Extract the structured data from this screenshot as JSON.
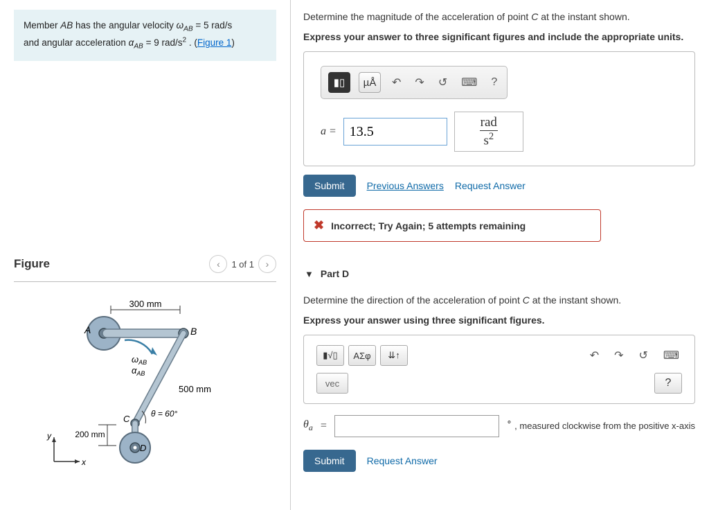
{
  "problem": {
    "prefix": "Member ",
    "member": "AB",
    "text1": " has the angular velocity ",
    "omega_var": "ω",
    "omega_sub": "AB",
    "omega_eq": " = 5  rad/s ",
    "text2": "and angular acceleration ",
    "alpha_var": "α",
    "alpha_sub": "AB",
    "alpha_eq": " = 9  rad/s",
    "alpha_exp": "2",
    "text3": " . (",
    "fig_link": "Figure 1",
    "text4": ")"
  },
  "figure": {
    "title": "Figure",
    "nav_label": "1 of 1",
    "labels": {
      "A": "A",
      "B": "B",
      "C": "C",
      "D": "D",
      "len_ab": "300 mm",
      "len_bc": "500 mm",
      "len_cd": "200 mm",
      "omega": "ω",
      "omega_sub": "AB",
      "alpha": "α",
      "alpha_sub": "AB",
      "theta": "θ = 60°",
      "x": "x",
      "y": "y"
    }
  },
  "partC": {
    "question": "Determine the magnitude of the acceleration of point C at the instant shown.",
    "instruction": "Express your answer to three significant figures and include the appropriate units.",
    "toolbar": {
      "templates": "▮▯",
      "units": "µÅ",
      "undo": "↶",
      "redo": "↷",
      "reset": "↺",
      "keyboard": "⌨",
      "help": "?"
    },
    "label": "a =",
    "value": "13.5",
    "unit_num": "rad",
    "unit_den": "s",
    "unit_exp": "2",
    "submit": "Submit",
    "prev_answers": "Previous Answers",
    "request_answer": "Request Answer",
    "feedback": "Incorrect; Try Again; 5 attempts remaining"
  },
  "partD": {
    "title": "Part D",
    "question": "Determine the direction of the acceleration of point C at the instant shown.",
    "instruction": "Express your answer using three significant figures.",
    "toolbar": {
      "fmt": "▮√▯",
      "greek": "ΑΣφ",
      "arrows": "⇊↑",
      "undo": "↶",
      "redo": "↷",
      "reset": "↺",
      "keyboard": "⌨",
      "vec": "vec",
      "help": "?"
    },
    "label_var": "θ",
    "label_sub": "a",
    "eq": "=",
    "suffix": " , measured clockwise from the positive x-axis",
    "deg": "∘",
    "submit": "Submit",
    "request_answer": "Request Answer"
  }
}
